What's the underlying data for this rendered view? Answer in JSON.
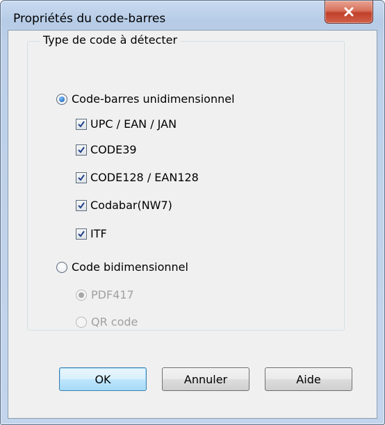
{
  "window": {
    "title": "Propriétés du code-barres",
    "close_icon": "close-icon"
  },
  "group": {
    "legend": "Type de code à détecter"
  },
  "options": {
    "one_d": {
      "label": "Code-barres unidimensionnel",
      "selected": true
    },
    "one_d_types": [
      {
        "label": "UPC / EAN / JAN",
        "checked": true
      },
      {
        "label": "CODE39",
        "checked": true
      },
      {
        "label": "CODE128 / EAN128",
        "checked": true
      },
      {
        "label": "Codabar(NW7)",
        "checked": true
      },
      {
        "label": "ITF",
        "checked": true
      }
    ],
    "two_d": {
      "label": "Code bidimensionnel",
      "selected": false
    },
    "two_d_types": [
      {
        "label": "PDF417",
        "selected": true,
        "enabled": false
      },
      {
        "label": "QR code",
        "selected": false,
        "enabled": false
      }
    ]
  },
  "buttons": {
    "ok": "OK",
    "cancel": "Annuler",
    "help": "Aide"
  },
  "colors": {
    "accent": "#1f63b8",
    "close_button": "#c2402a",
    "disabled_text": "#a0a0a0"
  }
}
